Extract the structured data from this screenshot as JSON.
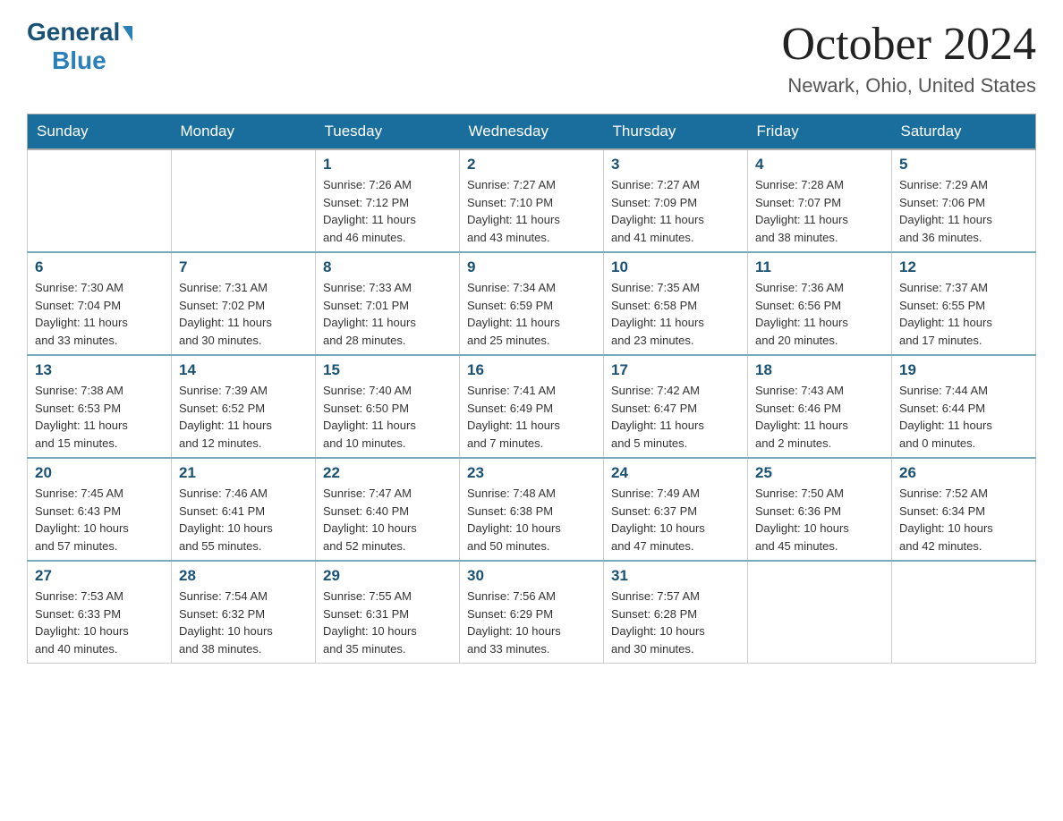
{
  "header": {
    "logo_general": "General",
    "logo_blue": "Blue",
    "month_title": "October 2024",
    "location": "Newark, Ohio, United States"
  },
  "days_of_week": [
    "Sunday",
    "Monday",
    "Tuesday",
    "Wednesday",
    "Thursday",
    "Friday",
    "Saturday"
  ],
  "weeks": [
    [
      {
        "day": "",
        "info": ""
      },
      {
        "day": "",
        "info": ""
      },
      {
        "day": "1",
        "info": "Sunrise: 7:26 AM\nSunset: 7:12 PM\nDaylight: 11 hours\nand 46 minutes."
      },
      {
        "day": "2",
        "info": "Sunrise: 7:27 AM\nSunset: 7:10 PM\nDaylight: 11 hours\nand 43 minutes."
      },
      {
        "day": "3",
        "info": "Sunrise: 7:27 AM\nSunset: 7:09 PM\nDaylight: 11 hours\nand 41 minutes."
      },
      {
        "day": "4",
        "info": "Sunrise: 7:28 AM\nSunset: 7:07 PM\nDaylight: 11 hours\nand 38 minutes."
      },
      {
        "day": "5",
        "info": "Sunrise: 7:29 AM\nSunset: 7:06 PM\nDaylight: 11 hours\nand 36 minutes."
      }
    ],
    [
      {
        "day": "6",
        "info": "Sunrise: 7:30 AM\nSunset: 7:04 PM\nDaylight: 11 hours\nand 33 minutes."
      },
      {
        "day": "7",
        "info": "Sunrise: 7:31 AM\nSunset: 7:02 PM\nDaylight: 11 hours\nand 30 minutes."
      },
      {
        "day": "8",
        "info": "Sunrise: 7:33 AM\nSunset: 7:01 PM\nDaylight: 11 hours\nand 28 minutes."
      },
      {
        "day": "9",
        "info": "Sunrise: 7:34 AM\nSunset: 6:59 PM\nDaylight: 11 hours\nand 25 minutes."
      },
      {
        "day": "10",
        "info": "Sunrise: 7:35 AM\nSunset: 6:58 PM\nDaylight: 11 hours\nand 23 minutes."
      },
      {
        "day": "11",
        "info": "Sunrise: 7:36 AM\nSunset: 6:56 PM\nDaylight: 11 hours\nand 20 minutes."
      },
      {
        "day": "12",
        "info": "Sunrise: 7:37 AM\nSunset: 6:55 PM\nDaylight: 11 hours\nand 17 minutes."
      }
    ],
    [
      {
        "day": "13",
        "info": "Sunrise: 7:38 AM\nSunset: 6:53 PM\nDaylight: 11 hours\nand 15 minutes."
      },
      {
        "day": "14",
        "info": "Sunrise: 7:39 AM\nSunset: 6:52 PM\nDaylight: 11 hours\nand 12 minutes."
      },
      {
        "day": "15",
        "info": "Sunrise: 7:40 AM\nSunset: 6:50 PM\nDaylight: 11 hours\nand 10 minutes."
      },
      {
        "day": "16",
        "info": "Sunrise: 7:41 AM\nSunset: 6:49 PM\nDaylight: 11 hours\nand 7 minutes."
      },
      {
        "day": "17",
        "info": "Sunrise: 7:42 AM\nSunset: 6:47 PM\nDaylight: 11 hours\nand 5 minutes."
      },
      {
        "day": "18",
        "info": "Sunrise: 7:43 AM\nSunset: 6:46 PM\nDaylight: 11 hours\nand 2 minutes."
      },
      {
        "day": "19",
        "info": "Sunrise: 7:44 AM\nSunset: 6:44 PM\nDaylight: 11 hours\nand 0 minutes."
      }
    ],
    [
      {
        "day": "20",
        "info": "Sunrise: 7:45 AM\nSunset: 6:43 PM\nDaylight: 10 hours\nand 57 minutes."
      },
      {
        "day": "21",
        "info": "Sunrise: 7:46 AM\nSunset: 6:41 PM\nDaylight: 10 hours\nand 55 minutes."
      },
      {
        "day": "22",
        "info": "Sunrise: 7:47 AM\nSunset: 6:40 PM\nDaylight: 10 hours\nand 52 minutes."
      },
      {
        "day": "23",
        "info": "Sunrise: 7:48 AM\nSunset: 6:38 PM\nDaylight: 10 hours\nand 50 minutes."
      },
      {
        "day": "24",
        "info": "Sunrise: 7:49 AM\nSunset: 6:37 PM\nDaylight: 10 hours\nand 47 minutes."
      },
      {
        "day": "25",
        "info": "Sunrise: 7:50 AM\nSunset: 6:36 PM\nDaylight: 10 hours\nand 45 minutes."
      },
      {
        "day": "26",
        "info": "Sunrise: 7:52 AM\nSunset: 6:34 PM\nDaylight: 10 hours\nand 42 minutes."
      }
    ],
    [
      {
        "day": "27",
        "info": "Sunrise: 7:53 AM\nSunset: 6:33 PM\nDaylight: 10 hours\nand 40 minutes."
      },
      {
        "day": "28",
        "info": "Sunrise: 7:54 AM\nSunset: 6:32 PM\nDaylight: 10 hours\nand 38 minutes."
      },
      {
        "day": "29",
        "info": "Sunrise: 7:55 AM\nSunset: 6:31 PM\nDaylight: 10 hours\nand 35 minutes."
      },
      {
        "day": "30",
        "info": "Sunrise: 7:56 AM\nSunset: 6:29 PM\nDaylight: 10 hours\nand 33 minutes."
      },
      {
        "day": "31",
        "info": "Sunrise: 7:57 AM\nSunset: 6:28 PM\nDaylight: 10 hours\nand 30 minutes."
      },
      {
        "day": "",
        "info": ""
      },
      {
        "day": "",
        "info": ""
      }
    ]
  ]
}
